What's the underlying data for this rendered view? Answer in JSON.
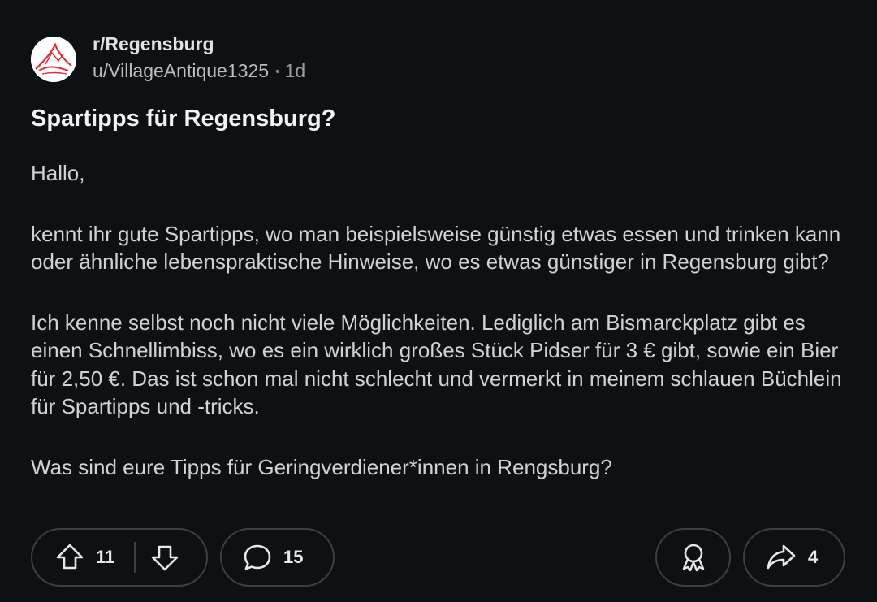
{
  "post": {
    "subreddit": "r/Regensburg",
    "author": "u/VillageAntique1325",
    "separator": "•",
    "age": "1d",
    "title": "Spartipps für Regensburg?",
    "paragraphs": [
      "Hallo,",
      "kennt ihr gute Spartipps, wo man beispielsweise günstig etwas essen und trinken kann oder ähnliche lebenspraktische Hinweise, wo es etwas günstiger in Regensburg gibt?",
      "Ich kenne selbst noch nicht viele Möglichkeiten. Lediglich am Bismarckplatz gibt es einen Schnellimbiss, wo es ein wirklich großes Stück Pidser für 3 € gibt, sowie ein Bier für 2,50 €. Das ist schon mal nicht schlecht und vermerkt in meinem schlauen Büchlein für Spartipps und -tricks.",
      "Was sind eure Tipps für Geringverdiener*innen in Rengsburg?"
    ]
  },
  "actions": {
    "upvote_icon": "arrow-up-icon",
    "vote_count": "11",
    "downvote_icon": "arrow-down-icon",
    "comment_icon": "comment-bubble-icon",
    "comment_count": "15",
    "award_icon": "award-ribbon-icon",
    "share_icon": "share-arrow-icon",
    "share_count": "4"
  },
  "colors": {
    "background": "#0e1113",
    "accent_avatar": "#e0303c"
  }
}
